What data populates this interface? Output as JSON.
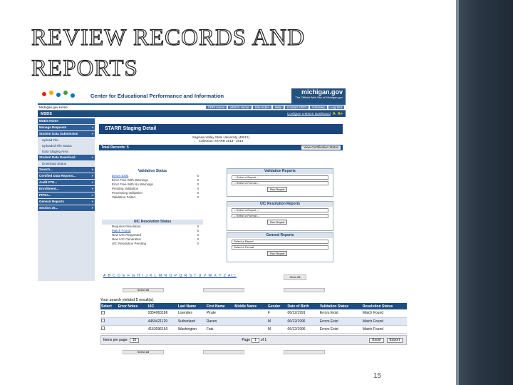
{
  "slide": {
    "title": "REVIEW RECORDS AND REPORTS",
    "page_number": "15"
  },
  "site": {
    "header_title": "Center for Educational Performance and Information",
    "michigan_logo": "michigan.gov",
    "michigan_sub": "The Official Web Site of Michigan.gov",
    "home_link": "Michigan.gov Home",
    "top_links": [
      "CEPI Home",
      "MSDS Home",
      "Site Index",
      "Help",
      "Contact CEPI",
      "Glossary",
      "Log Out"
    ],
    "app_name": "MSDS",
    "text_size_link": "Configure a MSDS Dashboard",
    "text_size_small": "A",
    "text_size_large": "A+"
  },
  "left_nav": [
    {
      "type": "m",
      "label": "MSDS Home",
      "arrow": ""
    },
    {
      "type": "m",
      "label": "Manage Requests",
      "arrow": "»"
    },
    {
      "type": "m",
      "label": "Student Data Submission",
      "arrow": "»"
    },
    {
      "type": "s",
      "label": "Upload File",
      "arrow": ""
    },
    {
      "type": "s",
      "label": "Uploaded File Status",
      "arrow": ""
    },
    {
      "type": "s",
      "label": "Data Staging Area",
      "arrow": ""
    },
    {
      "type": "m",
      "label": "Student Data Download",
      "arrow": "»"
    },
    {
      "type": "s",
      "label": "Download Status",
      "arrow": ""
    },
    {
      "type": "m",
      "label": "Search...",
      "arrow": "»"
    },
    {
      "type": "m",
      "label": "Certified Data Reports...",
      "arrow": "»"
    },
    {
      "type": "m",
      "label": "Audit FTE...",
      "arrow": "»"
    },
    {
      "type": "m",
      "label": "Enrollment...",
      "arrow": "»"
    },
    {
      "type": "m",
      "label": "PIPEs...",
      "arrow": "»"
    },
    {
      "type": "m",
      "label": "General Reports",
      "arrow": "»"
    },
    {
      "type": "m",
      "label": "Section 25...",
      "arrow": "»"
    }
  ],
  "staging": {
    "title": "STARR Staging Detail",
    "org_line": "Saginaw Valley State University (49012)",
    "collection_line": "Collection: STARR 2013 - 2014",
    "total_label": "Total Records: 5",
    "view_cert_button": "View Certification Status"
  },
  "validation_status": {
    "header": "Validation Status",
    "rows": [
      {
        "label": "Errors Exist",
        "count": "5",
        "link": true
      },
      {
        "label": "Error Free With Warnings",
        "count": "0",
        "link": false
      },
      {
        "label": "Error Free With No Warnings",
        "count": "0",
        "link": false
      },
      {
        "label": "Pending Validation",
        "count": "0",
        "link": false
      },
      {
        "label": "Processing Validation",
        "count": "0",
        "link": false
      },
      {
        "label": "Validation Failed",
        "count": "0",
        "link": false
      }
    ]
  },
  "uic_resolution": {
    "header": "UIC Resolution Status",
    "rows": [
      {
        "label": "Requires Resolution",
        "count": "0",
        "link": false
      },
      {
        "label": "Match Found",
        "count": "5",
        "link": true
      },
      {
        "label": "New UIC Requested",
        "count": "0",
        "link": false
      },
      {
        "label": "New UIC Generated",
        "count": "0",
        "link": false
      },
      {
        "label": "UIC Resolution Pending",
        "count": "0",
        "link": false
      }
    ]
  },
  "validation_reports": {
    "header": "Validation Reports",
    "select1": "-- Select a Report --",
    "select2": "-- Select a Format --",
    "run_button": "Run Report"
  },
  "uic_reports": {
    "header": "UIC Resolution Reports",
    "select1": "-- Select a Report --",
    "select2": "-- Select a Format --",
    "run_button": "Run Report"
  },
  "general_reports": {
    "header": "General Reports",
    "select1": "Select a Report",
    "select2": "Select a Format",
    "run_button": "Run Report"
  },
  "alpha_bar": {
    "letters": "A B C D E F G H I J K L M N O P Q R S T U V W X Y Z ALL",
    "clear_button": "Clear All"
  },
  "actions": {
    "select_all": "Select All",
    "select_all_bottom": "Select All"
  },
  "results": {
    "found_text": "Your search yielded 5 result(s).",
    "columns": [
      "Select",
      "Error Notes",
      "UIC",
      "Last Name",
      "First Name",
      "Middle Name",
      "Gender",
      "Date of Birth",
      "Validation Status",
      "Resolution Status"
    ],
    "rows": [
      [
        "",
        "",
        "9354963186",
        "Lowndes",
        "Pirate",
        "",
        "F",
        "06/12/1991",
        "Errors Exist",
        "Match Found"
      ],
      [
        "",
        "",
        "4450421129",
        "Sutherland",
        "Raven",
        "",
        "M",
        "06/12/1996",
        "Errors Exist",
        "Match Found"
      ],
      [
        "",
        "",
        "4153096160",
        "Washington",
        "Fats",
        "",
        "M",
        "06/12/1996",
        "Errors Exist",
        "Match Found"
      ]
    ]
  },
  "pager": {
    "items_label": "Items per page:",
    "items_value": "10",
    "page_label": "Page",
    "page_value": "1",
    "of_label": "of 1",
    "format_value": "Excel",
    "export_button": "Export"
  }
}
